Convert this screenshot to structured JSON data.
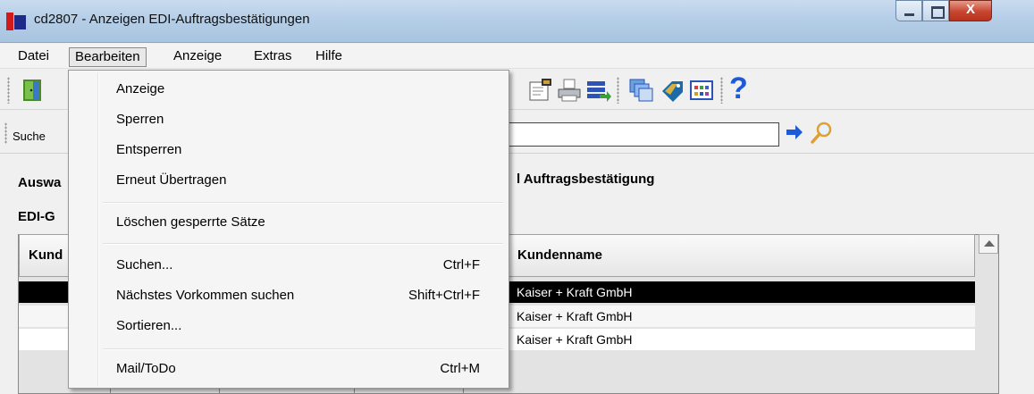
{
  "window": {
    "title": "cd2807 - Anzeigen EDI-Auftragsbestätigungen",
    "close_glyph": "X"
  },
  "menubar": {
    "items": [
      "Datei",
      "Bearbeiten",
      "Anzeige",
      "Extras",
      "Hilfe"
    ],
    "open": "Bearbeiten"
  },
  "search": {
    "label": "Suche",
    "value": ""
  },
  "content": {
    "auswahl_label": "Auswa",
    "auftrag_label": "l Auftragsbestätigung",
    "edi_label": "EDI-G"
  },
  "table": {
    "columns": [
      "Kund",
      "Kundenname"
    ],
    "rows": [
      {
        "kundenname": "Kaiser + Kraft GmbH",
        "selected": true
      },
      {
        "kundenname": "Kaiser + Kraft GmbH",
        "selected": false
      },
      {
        "kundenname": "Kaiser + Kraft GmbH",
        "selected": false
      }
    ]
  },
  "dropdown": {
    "items": [
      {
        "label": "Anzeige",
        "shortcut": ""
      },
      {
        "label": "Sperren",
        "shortcut": ""
      },
      {
        "label": "Entsperren",
        "shortcut": ""
      },
      {
        "label": "Erneut Übertragen",
        "shortcut": ""
      },
      {
        "label": "Löschen gesperrte Sätze",
        "shortcut": ""
      },
      {
        "label": "Suchen...",
        "shortcut": "Ctrl+F"
      },
      {
        "label": "Nächstes Vorkommen suchen",
        "shortcut": "Shift+Ctrl+F"
      },
      {
        "label": "Sortieren...",
        "shortcut": ""
      },
      {
        "label": "Mail/ToDo",
        "shortcut": "Ctrl+M"
      }
    ]
  },
  "toolbar": {
    "icons": [
      "exit-door-icon",
      "properties-icon",
      "print-icon",
      "export-icon",
      "windows-icon",
      "tag-icon",
      "table-icon",
      "help-icon"
    ],
    "help_glyph": "?"
  },
  "colors": {
    "selection": "#000000",
    "menu_bg": "#f5f5f5",
    "title_bar": "#b7cfe8"
  }
}
